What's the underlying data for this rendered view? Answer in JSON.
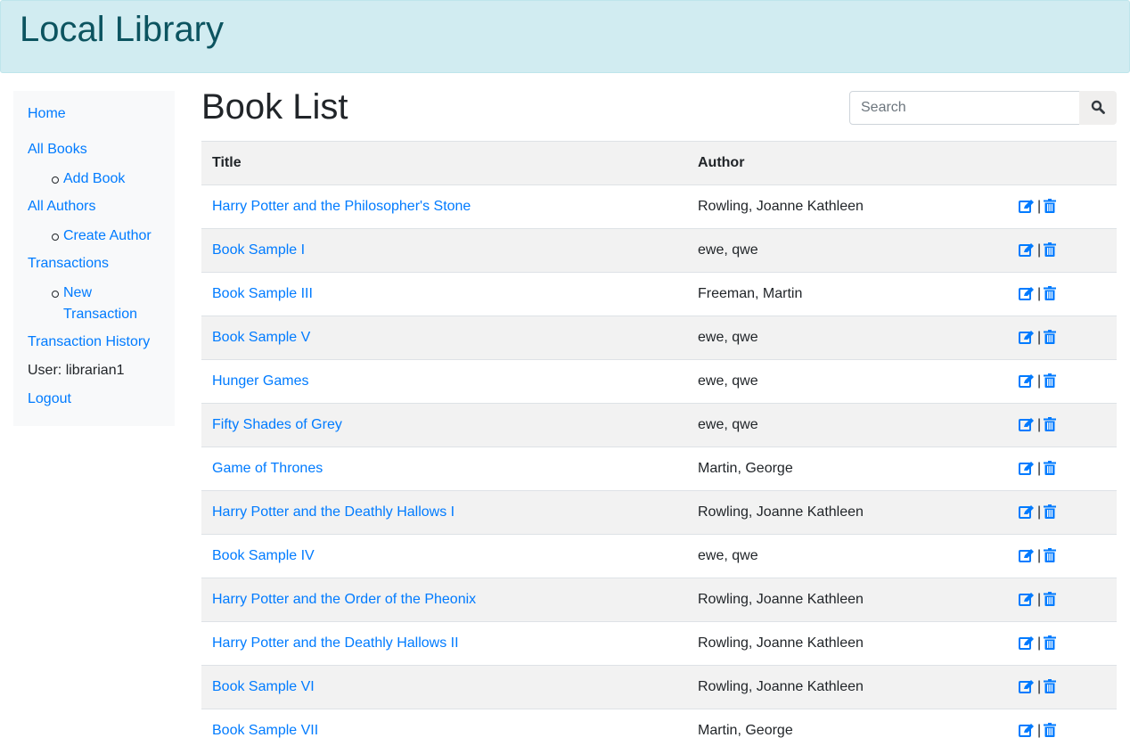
{
  "header": {
    "title": "Local Library"
  },
  "sidebar": {
    "home": "Home",
    "all_books": "All Books",
    "add_book": "Add Book",
    "all_authors": "All Authors",
    "create_author": "Create Author",
    "transactions": "Transactions",
    "new_transaction_1": "New",
    "new_transaction_2": "Transaction",
    "history": "Transaction History",
    "user_label": "User:",
    "user_name": "librarian1",
    "logout": "Logout"
  },
  "main": {
    "title": "Book List",
    "search_placeholder": "Search",
    "separator": "|"
  },
  "table": {
    "headers": [
      "Title",
      "Author"
    ],
    "rows": [
      {
        "title": "Harry Potter and the Philosopher's Stone",
        "author": "Rowling, Joanne Kathleen"
      },
      {
        "title": "Book Sample I",
        "author": "ewe, qwe"
      },
      {
        "title": "Book Sample III",
        "author": "Freeman, Martin"
      },
      {
        "title": "Book Sample V",
        "author": "ewe, qwe"
      },
      {
        "title": "Hunger Games",
        "author": "ewe, qwe"
      },
      {
        "title": "Fifty Shades of Grey",
        "author": "ewe, qwe"
      },
      {
        "title": "Game of Thrones",
        "author": "Martin, George"
      },
      {
        "title": "Harry Potter and the Deathly Hallows I",
        "author": "Rowling, Joanne Kathleen"
      },
      {
        "title": "Book Sample IV",
        "author": "ewe, qwe"
      },
      {
        "title": "Harry Potter and the Order of the Pheonix",
        "author": "Rowling, Joanne Kathleen"
      },
      {
        "title": "Harry Potter and the Deathly Hallows II",
        "author": "Rowling, Joanne Kathleen"
      },
      {
        "title": "Book Sample VI",
        "author": "Rowling, Joanne Kathleen"
      },
      {
        "title": "Book Sample VII",
        "author": "Martin, George"
      }
    ]
  }
}
